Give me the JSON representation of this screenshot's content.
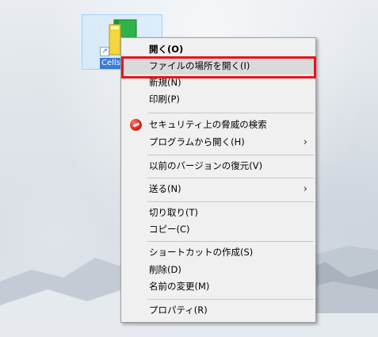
{
  "desktop": {
    "icon_label": "Cells"
  },
  "context_menu": {
    "items": [
      {
        "label": "開く(O)",
        "bold": true
      },
      {
        "label": "ファイルの場所を開く(I)",
        "highlighted": true
      },
      {
        "label": "新規(N)"
      },
      {
        "label": "印刷(P)"
      },
      {
        "label": "セキュリティ上の脅威の検索",
        "icon": "security-scan-icon"
      },
      {
        "label": "プログラムから開く(H)",
        "submenu": true
      },
      {
        "label": "以前のバージョンの復元(V)"
      },
      {
        "label": "送る(N)",
        "submenu": true
      },
      {
        "label": "切り取り(T)"
      },
      {
        "label": "コピー(C)"
      },
      {
        "label": "ショートカットの作成(S)"
      },
      {
        "label": "削除(D)"
      },
      {
        "label": "名前の変更(M)"
      },
      {
        "label": "プロパティ(R)"
      }
    ],
    "submenu_arrow": "›"
  },
  "colors": {
    "annotation_red": "#e8141c",
    "menu_bg": "#f0f0f0",
    "hover_bg": "#dadada"
  }
}
